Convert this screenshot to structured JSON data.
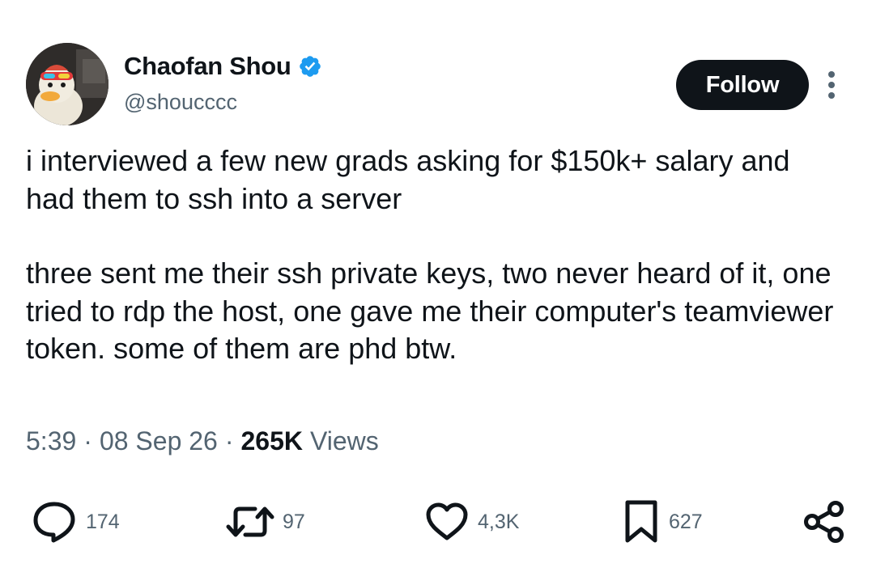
{
  "author": {
    "display_name": "Chaofan Shou",
    "handle": "@shoucccc",
    "verified_icon": "verified-badge-icon",
    "avatar_icon": "duck-avatar"
  },
  "follow_label": "Follow",
  "tweet": {
    "paragraph_1": "i interviewed a few new grads asking for $150k+ salary and had them to ssh into a server",
    "paragraph_2": "three sent me their ssh private keys, two never heard of it, one tried to rdp the host, one gave me their computer's teamviewer token. some of them are phd btw."
  },
  "meta": {
    "time": "5:39",
    "date": "08 Sep 26",
    "separator": "·",
    "views_count": "265K",
    "views_label": "Views"
  },
  "actions": {
    "replies": "174",
    "reposts": "97",
    "likes": "4,3K",
    "bookmarks": "627"
  },
  "colors": {
    "text_primary": "#0f1419",
    "text_secondary": "#536471",
    "verified_blue": "#1d9bf0",
    "button_bg": "#0f1419"
  }
}
